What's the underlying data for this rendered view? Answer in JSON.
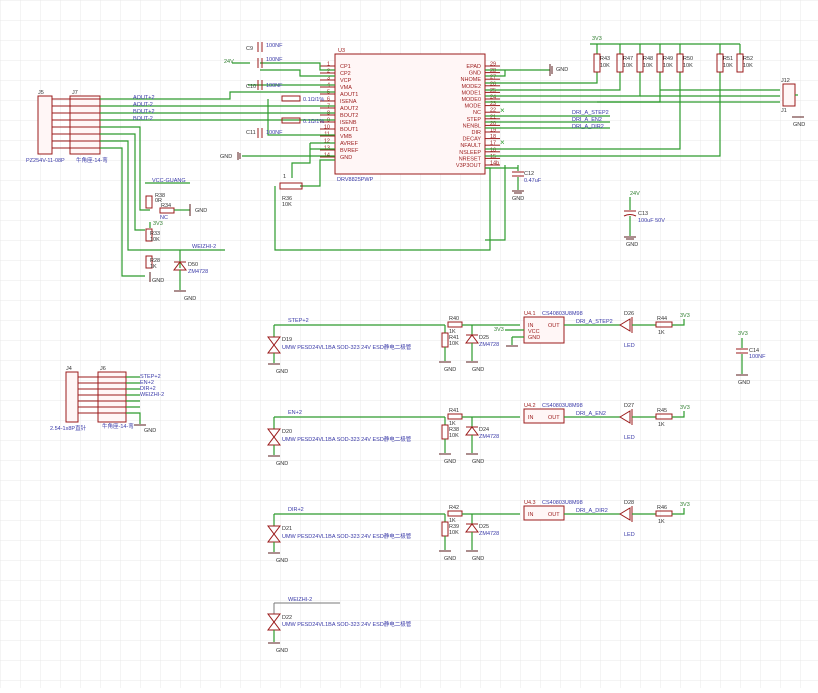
{
  "colors": {
    "wire": "#2d9b2d",
    "part": "#9b1b1b",
    "label": "#3a3aa8",
    "grid": "#e8e8e8"
  },
  "u3": {
    "ref": "U3",
    "part": "DRV8825PWP",
    "left_pins": [
      {
        "num": "1",
        "name": "CP1"
      },
      {
        "num": "2",
        "name": "CP2"
      },
      {
        "num": "3",
        "name": "VCP"
      },
      {
        "num": "4",
        "name": "VMA"
      },
      {
        "num": "5",
        "name": "AOUT1"
      },
      {
        "num": "6",
        "name": "ISENA"
      },
      {
        "num": "7",
        "name": "AOUT2"
      },
      {
        "num": "8",
        "name": "BOUT2"
      },
      {
        "num": "9",
        "name": "ISENB"
      },
      {
        "num": "10",
        "name": "BOUT1"
      },
      {
        "num": "11",
        "name": "VMB"
      },
      {
        "num": "12",
        "name": "AVREF"
      },
      {
        "num": "13",
        "name": "BVREF"
      },
      {
        "num": "14",
        "name": "GND"
      }
    ],
    "right_pins": [
      {
        "num": "29",
        "name": "EPAD"
      },
      {
        "num": "28",
        "name": "GND"
      },
      {
        "num": "27",
        "name": "NHOME"
      },
      {
        "num": "26",
        "name": "MODE2"
      },
      {
        "num": "25",
        "name": "MODE1"
      },
      {
        "num": "24",
        "name": "MODE0"
      },
      {
        "num": "23",
        "name": "MODE"
      },
      {
        "num": "22",
        "name": "NC"
      },
      {
        "num": "21",
        "name": "STEP"
      },
      {
        "num": "20",
        "name": "NENBL"
      },
      {
        "num": "19",
        "name": "DIR"
      },
      {
        "num": "18",
        "name": "DECAY"
      },
      {
        "num": "17",
        "name": "NFAULT"
      },
      {
        "num": "16",
        "name": "NSLEEP"
      },
      {
        "num": "15",
        "name": "NRESET"
      },
      {
        "num": "14b",
        "name": "V3P3OUT"
      }
    ]
  },
  "capacitors": {
    "c9": {
      "ref": "C9",
      "val": "100NF"
    },
    "c10": {
      "ref": "C10",
      "val": "100NF"
    },
    "c11": {
      "ref": "C11",
      "val": "100NF"
    },
    "c12": {
      "ref": "C12",
      "val": "0.47uF"
    },
    "c13": {
      "ref": "C13",
      "val": "100uF 50V"
    },
    "c14": {
      "ref": "C14",
      "val": "100NF"
    },
    "c8": {
      "ref": "C8",
      "val": "100NF"
    }
  },
  "nets": {
    "aout_p": "AOUT+2",
    "aout_m": "AOUT-2",
    "bout_p": "BOUT+2",
    "bout_m": "BOUT-2",
    "vcc_guang": "VCC-GUANG",
    "weizhi": "WEIZHI-2",
    "step": "STEP+2",
    "en": "EN+2",
    "dir": "DIR+2",
    "dri_step": "DRI_A_STEP2",
    "dri_en": "DRI_A_EN2",
    "dri_dir": "DRI_A_DIR2",
    "v24": "24V",
    "v3": "3V3",
    "gnd": "GND"
  },
  "resistors": [
    {
      "ref": "R43",
      "val": "10K"
    },
    {
      "ref": "R47",
      "val": "10K"
    },
    {
      "ref": "R48",
      "val": "10K"
    },
    {
      "ref": "R49",
      "val": "10K"
    },
    {
      "ref": "R50",
      "val": "10K"
    },
    {
      "ref": "R51",
      "val": "10K"
    },
    {
      "ref": "R52",
      "val": "10K"
    }
  ],
  "connectors": {
    "j5": {
      "ref": "J5",
      "part": "PZ254V-11-08P"
    },
    "j7": {
      "ref": "J7",
      "part": "牛角座-14-弯"
    },
    "j4": {
      "ref": "J4",
      "part": "2.54-1x8P直针"
    },
    "j6": {
      "ref": "J6",
      "part": "牛角座-14-弯"
    },
    "j1": {
      "ref": "J1"
    },
    "j12": {
      "ref": "J12"
    }
  },
  "misc": {
    "r36": {
      "ref": "R36",
      "val": "10K"
    },
    "r38": {
      "ref": "R38",
      "val": "0R"
    },
    "r34": {
      "ref": "R34",
      "val": "NC"
    },
    "r33": {
      "ref": "R33",
      "val": "10K"
    },
    "r28": {
      "ref": "R28",
      "val": "1K"
    },
    "d50": {
      "ref": "D50",
      "val": "ZM4728"
    },
    "sense_r": "0.1Ω/1%"
  },
  "channels": [
    {
      "net_in": "STEP+2",
      "d_esd": "D19",
      "esd_part": "UMW PESD24VL1BA SOD-323 24V ESD静电二极管",
      "r_ser": "R40",
      "r_ser_val": "1K",
      "r_pd": "R41",
      "r_pd_val": "10K",
      "zener": "D25",
      "zener_val": "ZM4728",
      "opto": "U4.1",
      "opto_part": "CS40803U8M98",
      "opto_pins": [
        "IN",
        "OUT",
        "VCC",
        "GND"
      ],
      "net_out": "DRI_A_STEP2",
      "led_r": "R44",
      "led_r_val": "1K",
      "led": "D26",
      "led_lbl": "LED"
    },
    {
      "net_in": "EN+2",
      "d_esd": "D20",
      "esd_part": "UMW PESD24VL1BA SOD-323 24V ESD静电二极管",
      "r_ser": "R41",
      "r_ser_val": "1K",
      "r_pd": "R38",
      "r_pd_val": "10K",
      "zener": "D24",
      "zener_val": "ZM4728",
      "opto": "U4.2",
      "opto_part": "CS40803U8M98",
      "opto_pins": [
        "IN",
        "OUT"
      ],
      "net_out": "DRI_A_EN2",
      "led_r": "R45",
      "led_r_val": "1K",
      "led": "D27",
      "led_lbl": "LED"
    },
    {
      "net_in": "DIR+2",
      "d_esd": "D21",
      "esd_part": "UMW PESD24VL1BA SOD-323 24V ESD静电二极管",
      "r_ser": "R42",
      "r_ser_val": "1K",
      "r_pd": "R39",
      "r_pd_val": "10K",
      "zener": "D25",
      "zener_val": "ZM4728",
      "opto": "U4.3",
      "opto_part": "CS40803U8M98",
      "opto_pins": [
        "IN",
        "OUT"
      ],
      "net_out": "DRI_A_DIR2",
      "led_r": "R46",
      "led_r_val": "1K",
      "led": "D28",
      "led_lbl": "LED"
    }
  ],
  "weizhi_esd": {
    "net": "WEIZHI-2",
    "d": "D22",
    "part": "UMW PESD24VL1BA SOD-323 24V ESD静电二极管"
  },
  "j6_nets": [
    "STEP+2",
    "EN+2",
    "DIR+2",
    "WEIZHI-2"
  ]
}
